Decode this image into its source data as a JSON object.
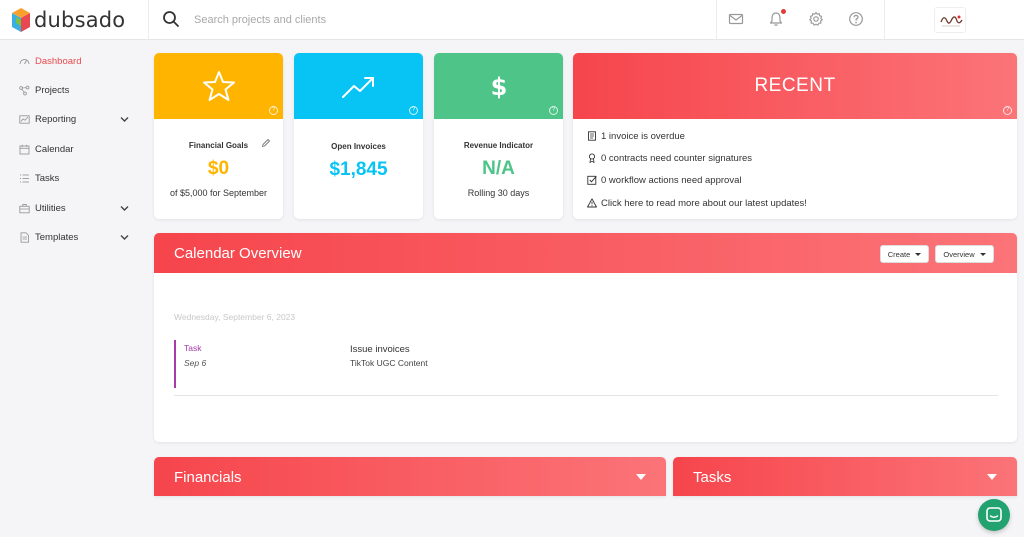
{
  "app": {
    "logo_text": "dubsado",
    "search_placeholder": "Search projects and clients"
  },
  "sidebar": {
    "items": [
      {
        "label": "Dashboard",
        "icon": "dashboard-icon"
      },
      {
        "label": "Projects",
        "icon": "projects-icon"
      },
      {
        "label": "Reporting",
        "icon": "reporting-icon"
      },
      {
        "label": "Calendar",
        "icon": "calendar-icon"
      },
      {
        "label": "Tasks",
        "icon": "tasks-icon"
      },
      {
        "label": "Utilities",
        "icon": "utilities-icon"
      },
      {
        "label": "Templates",
        "icon": "templates-icon"
      }
    ]
  },
  "cards": {
    "financial_goals": {
      "title": "Financial Goals",
      "value": "$0",
      "sub": "of $5,000 for September",
      "color": "#ffb400"
    },
    "open_invoices": {
      "title": "Open Invoices",
      "value": "$1,845",
      "color": "#08c4f5"
    },
    "revenue_indicator": {
      "title": "Revenue Indicator",
      "value": "N/A",
      "sub": "Rolling 30 days",
      "color": "#4fc489"
    },
    "help_glyph": "?"
  },
  "recent": {
    "title": "RECENT",
    "items": [
      "1 invoice is overdue",
      "0 contracts need counter signatures",
      "0 workflow actions need approval",
      "Click here to read more about our latest updates!"
    ]
  },
  "calendar_overview": {
    "title": "Calendar Overview",
    "create_label": "Create",
    "overview_label": "Overview",
    "date": "Wednesday, September 6, 2023",
    "event": {
      "type": "Task",
      "date": "Sep 6",
      "name": "Issue invoices",
      "project": "TikTok UGC Content"
    }
  },
  "financials": {
    "title": "Financials"
  },
  "tasks": {
    "title": "Tasks"
  },
  "colors": {
    "accent": "#e84a4f",
    "header_red": "#f6454c",
    "chat": "#22a26f"
  }
}
